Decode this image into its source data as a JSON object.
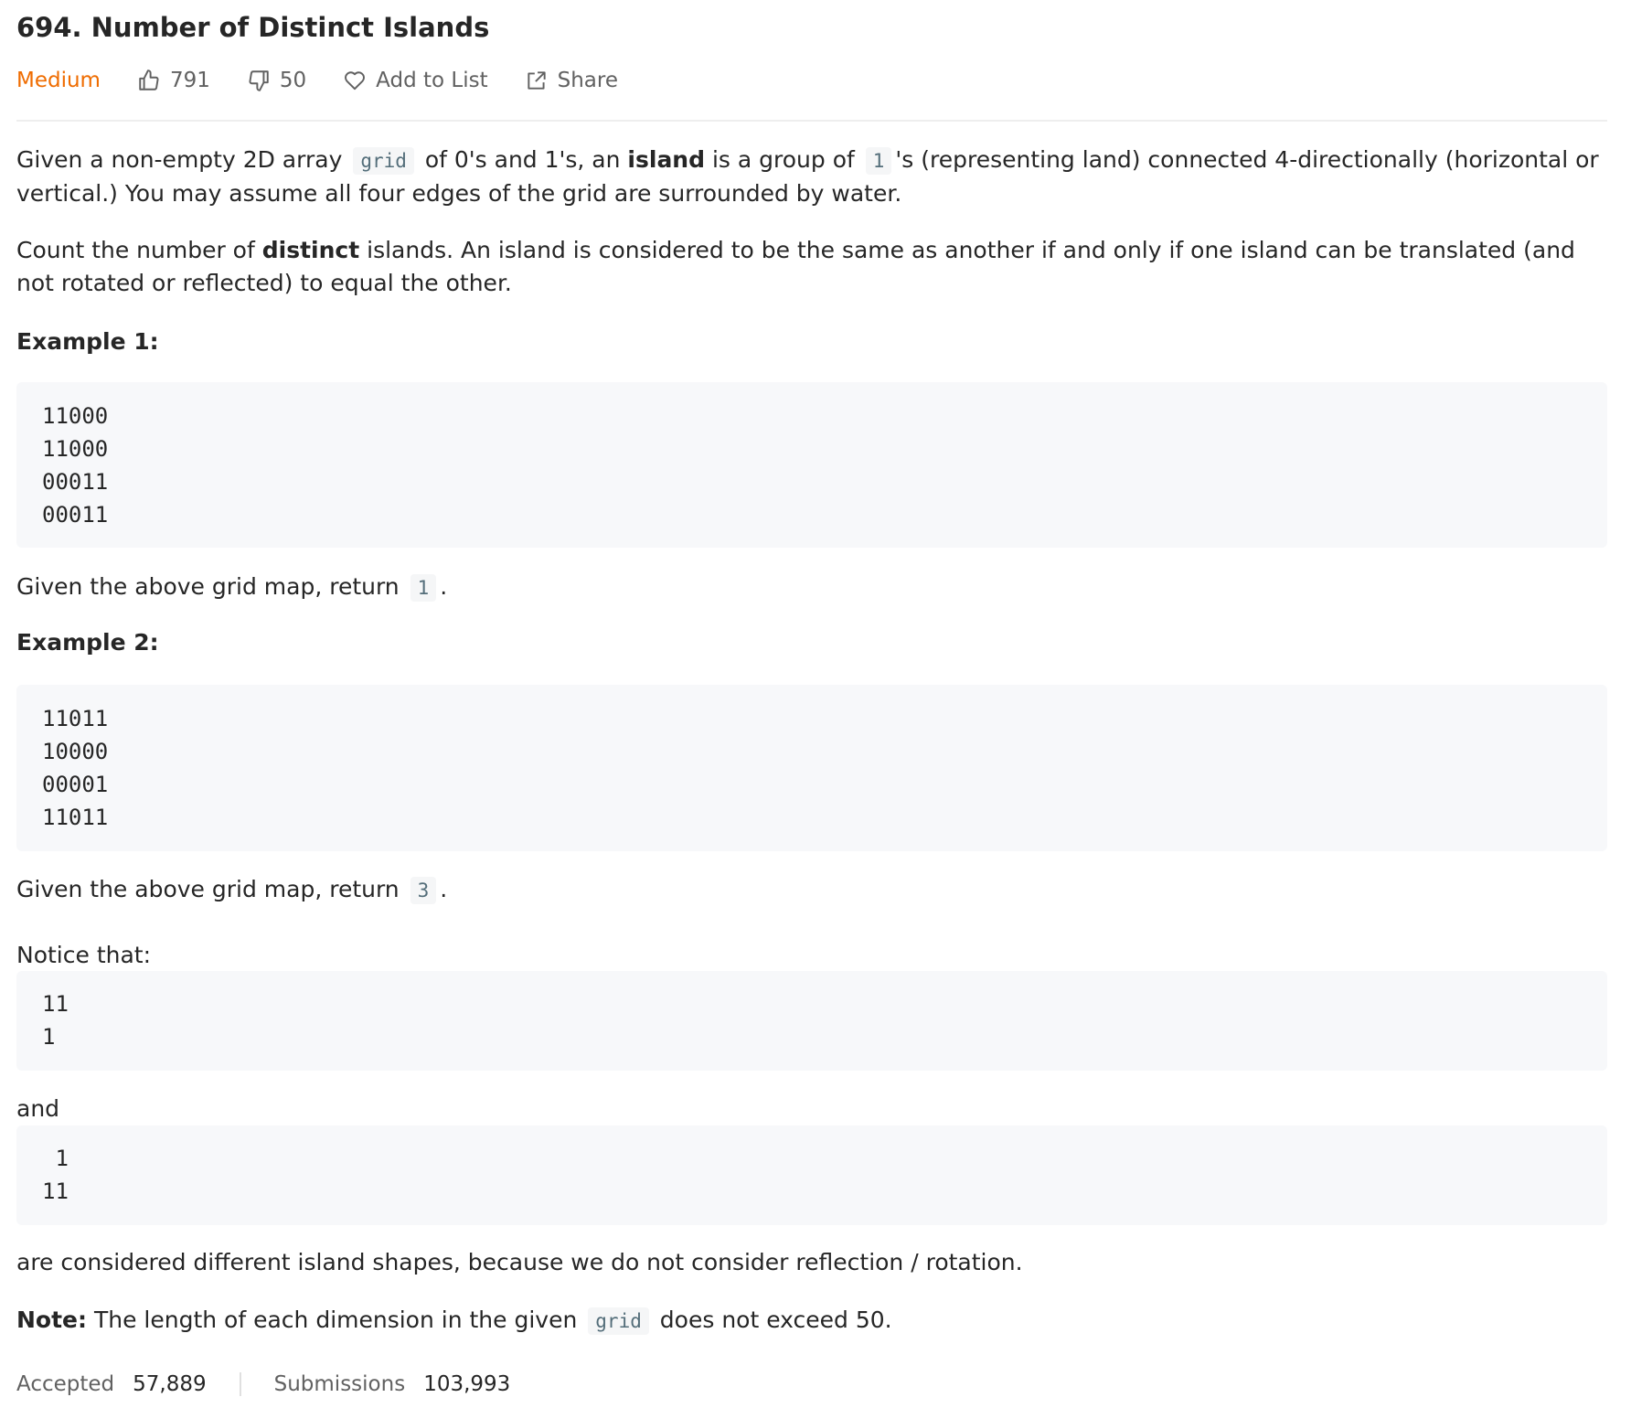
{
  "problem": {
    "title": "694. Number of Distinct Islands",
    "difficulty": "Medium",
    "likes": "791",
    "dislikes": "50",
    "add_to_list": "Add to List",
    "share": "Share"
  },
  "description": {
    "p1_a": "Given a non-empty 2D array ",
    "p1_code1": "grid",
    "p1_b": " of 0's and 1's, an ",
    "p1_bold": "island",
    "p1_c": " is a group of ",
    "p1_code2": "1",
    "p1_d": "'s (representing land) connected 4-directionally (horizontal or vertical.) You may assume all four edges of the grid are surrounded by water.",
    "p2_a": "Count the number of ",
    "p2_bold": "distinct",
    "p2_b": " islands. An island is considered to be the same as another if and only if one island can be translated (and not rotated or reflected) to equal the other.",
    "example1_heading": "Example 1:",
    "example1_lines": [
      "11000",
      "11000",
      "00011",
      "00011"
    ],
    "example1_result_a": "Given the above grid map, return ",
    "example1_result_code": "1",
    "example1_result_b": ".",
    "example2_heading": "Example 2:",
    "example2_lines": [
      "11011",
      "10000",
      "00001",
      "11011"
    ],
    "example2_result_a": "Given the above grid map, return ",
    "example2_result_code": "3",
    "example2_result_b": ".",
    "notice": "Notice that:",
    "notice_lines": [
      "11",
      "1"
    ],
    "and": "and",
    "and_lines": [
      " 1",
      "11"
    ],
    "different": "are considered different island shapes, because we do not consider reflection / rotation.",
    "note_bold": "Note:",
    "note_a": " The length of each dimension in the given ",
    "note_code": "grid",
    "note_b": " does not exceed 50."
  },
  "stats": {
    "accepted_label": "Accepted",
    "accepted_value": "57,889",
    "submissions_label": "Submissions",
    "submissions_value": "103,993"
  },
  "colors": {
    "difficulty": "#ef6c00",
    "code_bg": "#f7f8fa",
    "muted": "#616161"
  }
}
